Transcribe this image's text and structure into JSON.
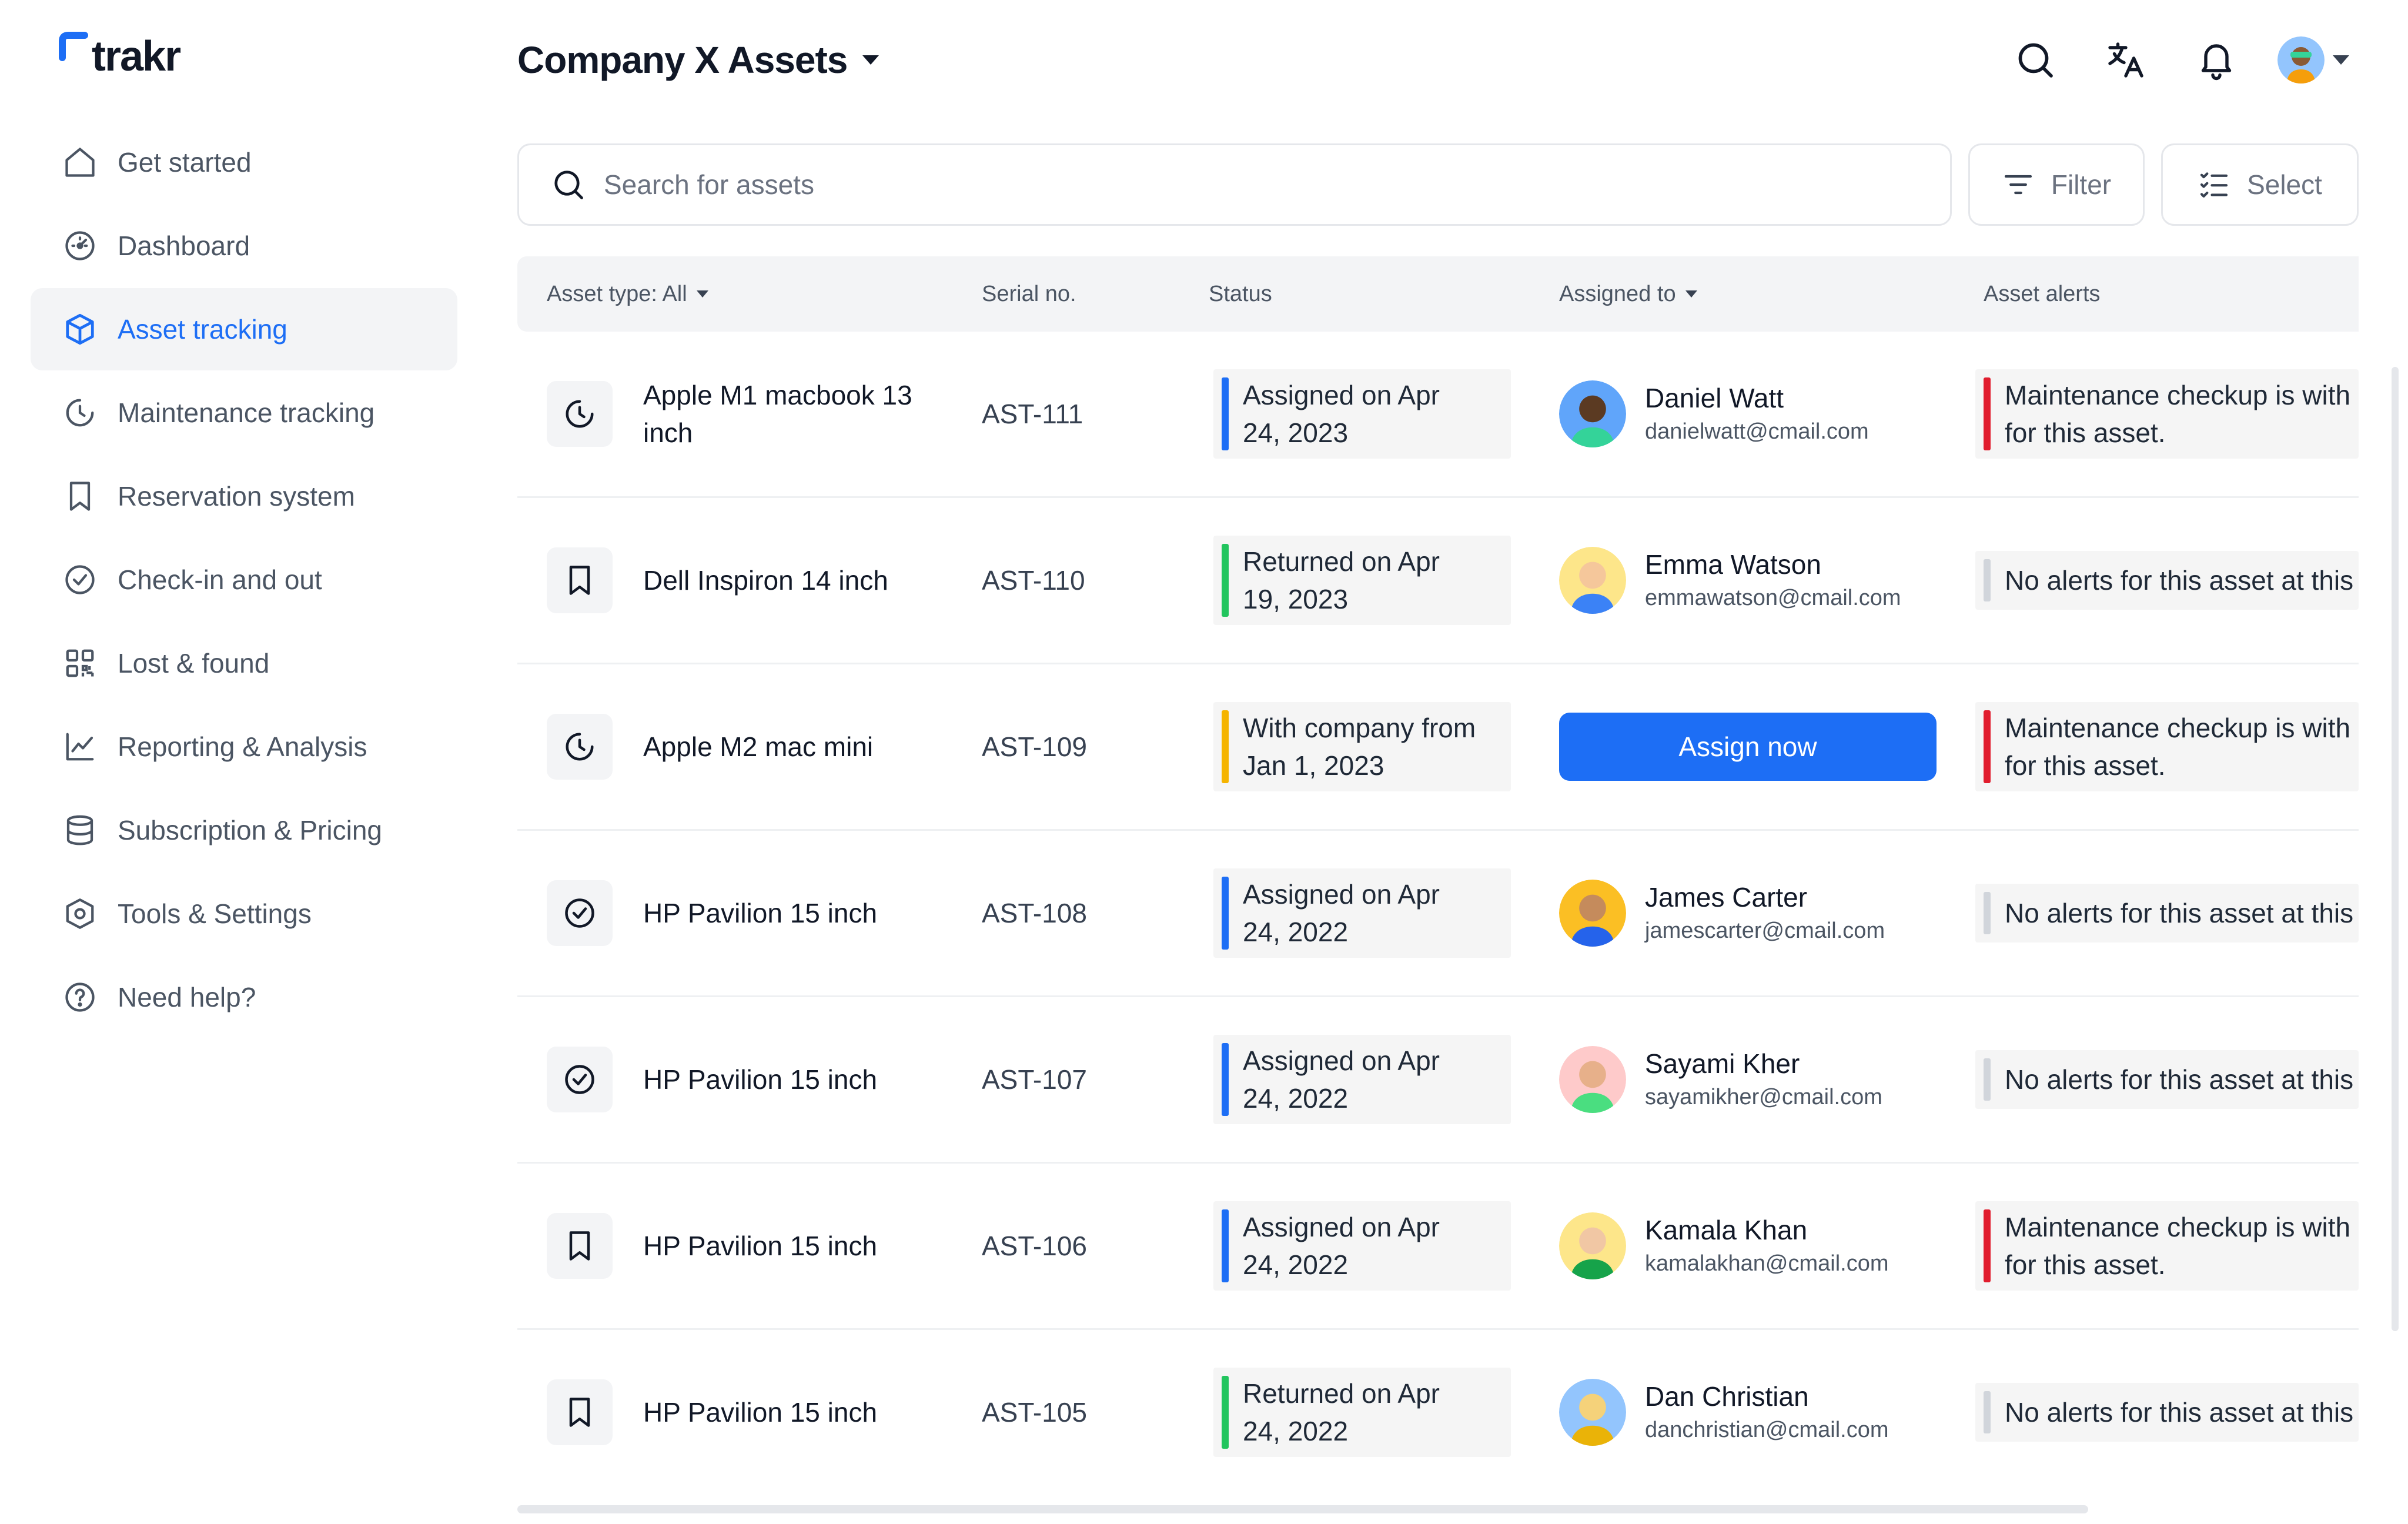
{
  "app": {
    "logo_text": "trakr",
    "title": "Company X Assets"
  },
  "sidebar": {
    "items": [
      {
        "label": "Get started",
        "icon": "home-icon",
        "active": false
      },
      {
        "label": "Dashboard",
        "icon": "gauge-icon",
        "active": false
      },
      {
        "label": "Asset tracking",
        "icon": "cube-icon",
        "active": true
      },
      {
        "label": "Maintenance tracking",
        "icon": "clock-icon",
        "active": false
      },
      {
        "label": "Reservation system",
        "icon": "bookmark-icon",
        "active": false
      },
      {
        "label": "Check-in and out",
        "icon": "check-circle-icon",
        "active": false
      },
      {
        "label": "Lost & found",
        "icon": "qr-code-icon",
        "active": false
      },
      {
        "label": "Reporting & Analysis",
        "icon": "line-chart-icon",
        "active": false
      },
      {
        "label": "Subscription & Pricing",
        "icon": "database-icon",
        "active": false
      },
      {
        "label": "Tools & Settings",
        "icon": "hex-settings-icon",
        "active": false
      },
      {
        "label": "Need help?",
        "icon": "help-circle-icon",
        "active": false
      }
    ]
  },
  "header": {
    "icons": [
      "search-icon",
      "translate-icon",
      "bell-icon",
      "user-avatar"
    ]
  },
  "search": {
    "placeholder": "Search for assets",
    "value": ""
  },
  "toolbar": {
    "filter_label": "Filter",
    "select_label": "Select"
  },
  "table": {
    "columns": {
      "asset_type": "Asset type: All",
      "serial": "Serial no.",
      "status": "Status",
      "assigned": "Assigned to",
      "alerts": "Asset alerts"
    },
    "rows": [
      {
        "type_icon": "clock-icon",
        "name": "Apple M1 macbook 13 inch",
        "serial": "AST-111",
        "status": "Assigned on Apr 24, 2023",
        "status_color": "#1d6ef5",
        "person_name": "Daniel Watt",
        "person_email": "danielwatt@cmail.com",
        "alert": "Maintenance checkup is with for this asset.",
        "alert_color": "#e11d2e"
      },
      {
        "type_icon": "bookmark-icon",
        "name": "Dell Inspiron 14 inch",
        "serial": "AST-110",
        "status": "Returned on Apr 19, 2023",
        "status_color": "#22c55e",
        "person_name": "Emma Watson",
        "person_email": "emmawatson@cmail.com",
        "alert": "No alerts for this asset at this",
        "alert_color": "#d1d5db"
      },
      {
        "type_icon": "clock-icon",
        "name": "Apple M2 mac mini",
        "serial": "AST-109",
        "status": "With company from Jan 1, 2023",
        "status_color": "#f5b400",
        "assign_label": "Assign now",
        "alert": "Maintenance checkup is with for this asset.",
        "alert_color": "#e11d2e"
      },
      {
        "type_icon": "check-circle-icon",
        "name": "HP Pavilion 15 inch",
        "serial": "AST-108",
        "status": "Assigned on Apr 24, 2022",
        "status_color": "#1d6ef5",
        "person_name": "James Carter",
        "person_email": "jamescarter@cmail.com",
        "alert": "No alerts for this asset at this",
        "alert_color": "#d1d5db"
      },
      {
        "type_icon": "check-circle-icon",
        "name": "HP Pavilion 15 inch",
        "serial": "AST-107",
        "status": "Assigned on Apr 24, 2022",
        "status_color": "#1d6ef5",
        "person_name": "Sayami Kher",
        "person_email": "sayamikher@cmail.com",
        "alert": "No alerts for this asset at this",
        "alert_color": "#d1d5db"
      },
      {
        "type_icon": "bookmark-icon",
        "name": "HP Pavilion 15 inch",
        "serial": "AST-106",
        "status": "Assigned on Apr 24, 2022",
        "status_color": "#1d6ef5",
        "person_name": "Kamala Khan",
        "person_email": "kamalakhan@cmail.com",
        "alert": "Maintenance checkup is with for this asset.",
        "alert_color": "#e11d2e"
      },
      {
        "type_icon": "bookmark-icon",
        "name": "HP Pavilion 15 inch",
        "serial": "AST-105",
        "status": "Returned on Apr 24, 2022",
        "status_color": "#22c55e",
        "person_name": "Dan Christian",
        "person_email": "danchristian@cmail.com",
        "alert": "No alerts for this asset at this",
        "alert_color": "#d1d5db"
      }
    ]
  },
  "colors": {
    "accent": "#1d6ef5"
  }
}
